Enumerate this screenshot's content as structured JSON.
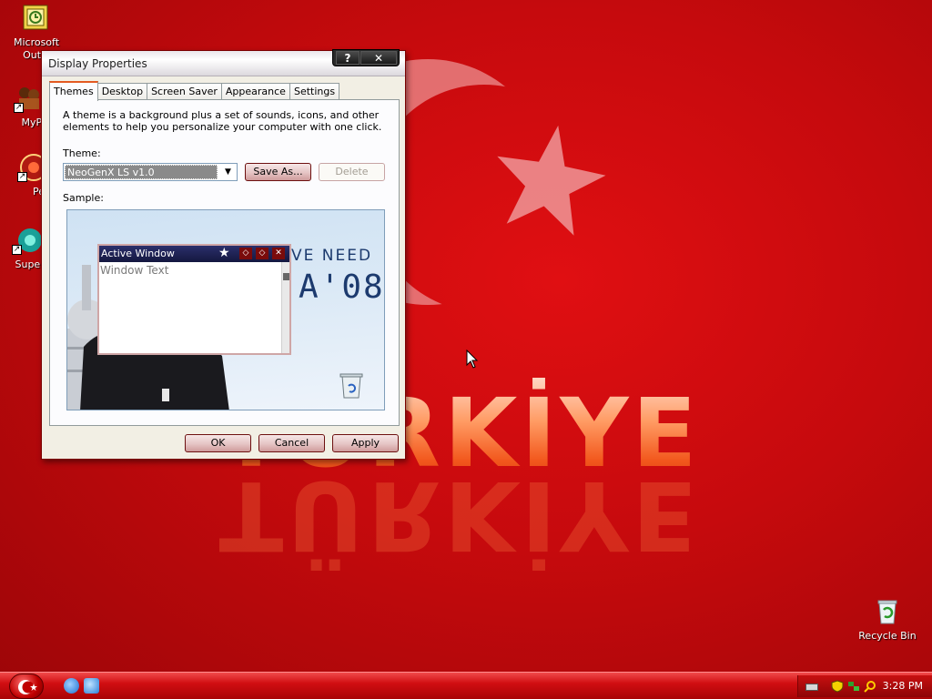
{
  "desktop": {
    "wallpaper_text": "TÜRKİYE",
    "icons": [
      {
        "label": "Microsoft Outlo",
        "icon": "outlook-icon"
      },
      {
        "label": "MyPa",
        "icon": "folder-people-icon"
      },
      {
        "label": "Peg",
        "icon": "pegasus-icon"
      },
      {
        "label": "Supern",
        "icon": "supernova-icon"
      },
      {
        "label": "Recycle Bin",
        "icon": "recycle-bin-icon"
      }
    ]
  },
  "dialog": {
    "title": "Display Properties",
    "help_button": "?",
    "close_button": "✕",
    "tabs": [
      "Themes",
      "Desktop",
      "Screen Saver",
      "Appearance",
      "Settings"
    ],
    "active_tab": "Themes",
    "description": "A theme is a background plus a set of sounds, icons, and other elements to help you personalize your computer with one click.",
    "theme_label": "Theme:",
    "theme_value": "NeoGenX LS v1.0",
    "save_as_button": "Save As...",
    "delete_button": "Delete",
    "sample_label": "Sample:",
    "sample": {
      "active_window_title": "Active Window",
      "window_text": "Window Text",
      "banner_line1": "VE NEED",
      "banner_line2": "A'08"
    },
    "ok_button": "OK",
    "cancel_button": "Cancel",
    "apply_button": "Apply"
  },
  "taskbar": {
    "clock": "3:28 PM"
  },
  "colors": {
    "desktop_red": "#c60a0d",
    "taskbar_red": "#d10e12",
    "tab_accent": "#e35a21"
  }
}
